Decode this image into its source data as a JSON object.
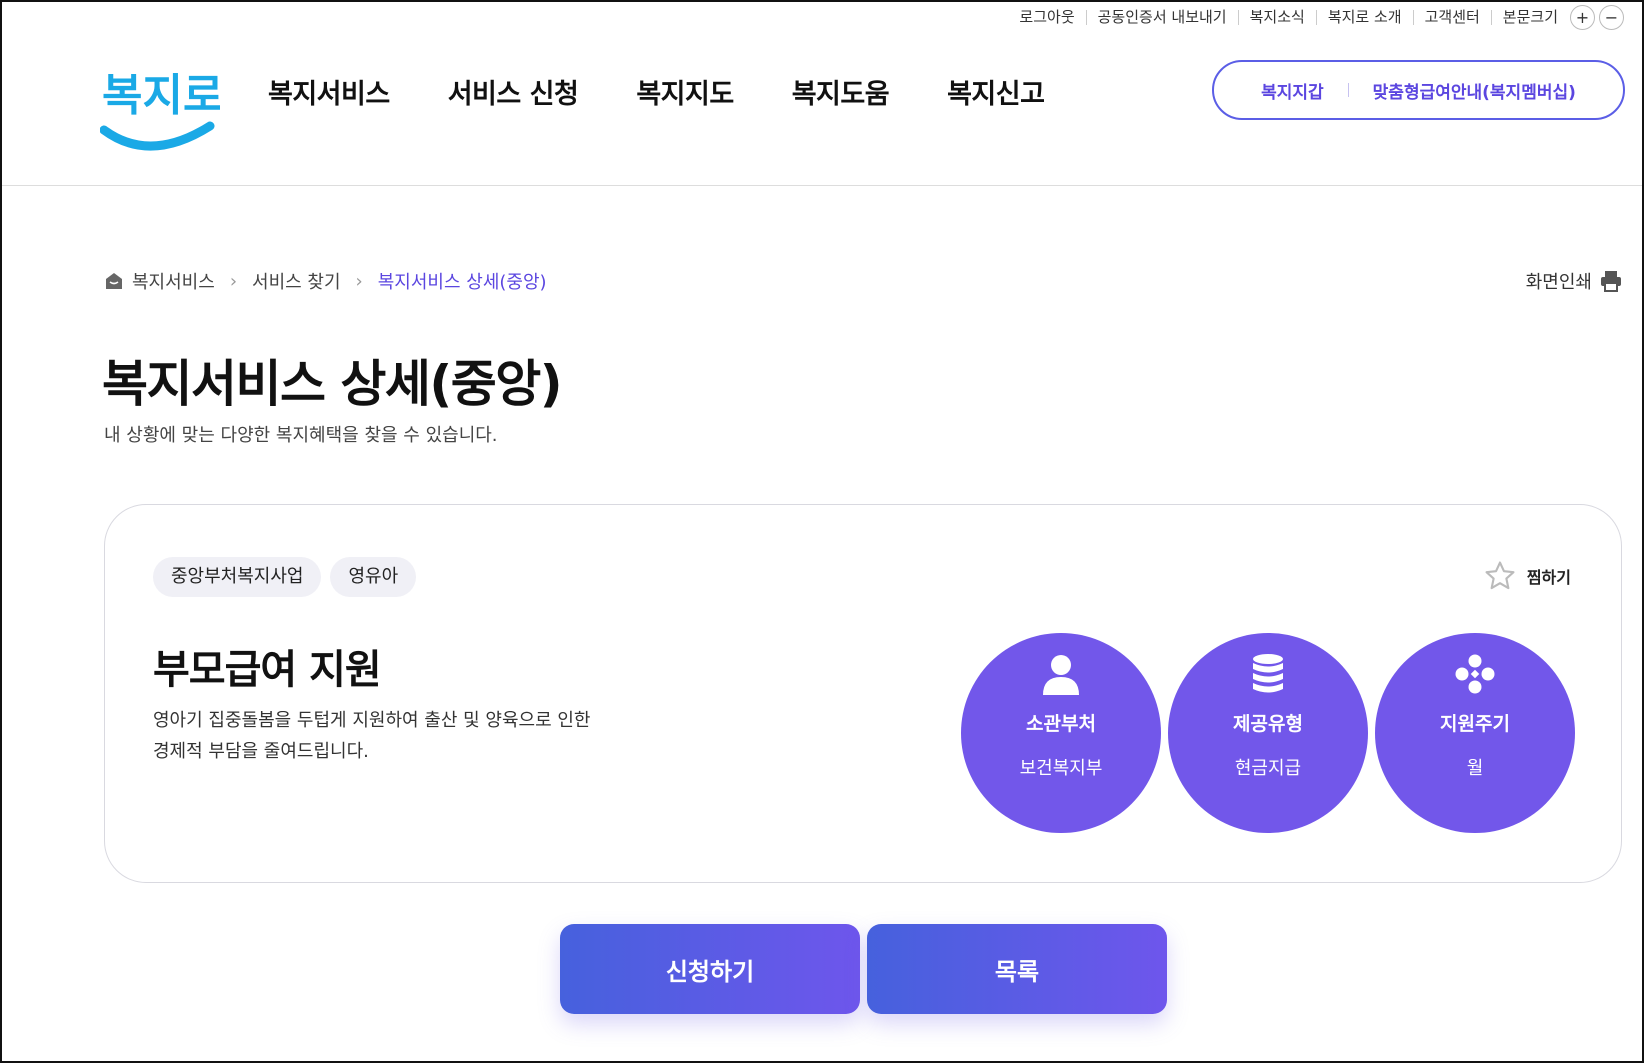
{
  "utility": {
    "links": [
      "로그아웃",
      "공동인증서 내보내기",
      "복지소식",
      "복지로 소개",
      "고객센터"
    ],
    "font_size_label": "본문크기",
    "plus": "+",
    "minus": "−"
  },
  "header": {
    "logo_text": "복지로",
    "nav": [
      "복지서비스",
      "서비스 신청",
      "복지지도",
      "복지도움",
      "복지신고"
    ],
    "pill": [
      "복지지갑",
      "맞춤형급여안내(복지멤버십)"
    ]
  },
  "breadcrumb": {
    "items": [
      "복지서비스",
      "서비스 찾기",
      "복지서비스 상세(중앙)"
    ],
    "separator": "›"
  },
  "print_label": "화면인쇄",
  "page": {
    "title": "복지서비스 상세(중앙)",
    "subtitle": "내 상황에 맞는 다양한 복지혜택을 찾을 수 있습니다."
  },
  "service": {
    "tags": [
      "중앙부처복지사업",
      "영유아"
    ],
    "favorite_label": "찜하기",
    "title": "부모급여 지원",
    "description_lines": [
      "영아기 집중돌봄을 두텁게 지원하여 출산 및 양육으로 인한",
      "경제적 부담을 줄여드립니다."
    ],
    "info": [
      {
        "icon": "person-icon",
        "label": "소관부처",
        "value": "보건복지부"
      },
      {
        "icon": "coin-stack-icon",
        "label": "제공유형",
        "value": "현금지급"
      },
      {
        "icon": "cycle-dots-icon",
        "label": "지원주기",
        "value": "월"
      }
    ]
  },
  "actions": {
    "apply": "신청하기",
    "list": "목록"
  },
  "colors": {
    "accent": "#7257ea",
    "link": "#5b46e0",
    "logo": "#1aa9e6"
  }
}
